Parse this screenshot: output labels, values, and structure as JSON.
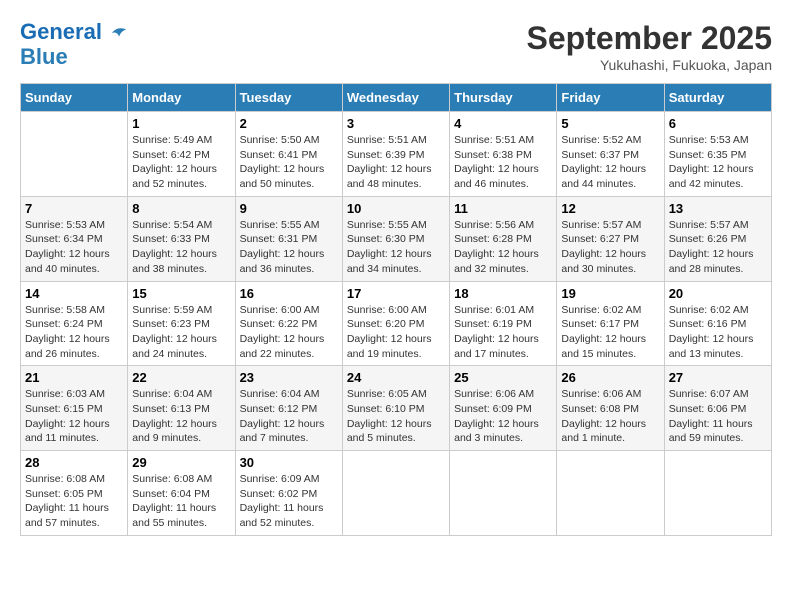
{
  "header": {
    "logo_line1": "General",
    "logo_line2": "Blue",
    "month_title": "September 2025",
    "location": "Yukuhashi, Fukuoka, Japan"
  },
  "days_of_week": [
    "Sunday",
    "Monday",
    "Tuesday",
    "Wednesday",
    "Thursday",
    "Friday",
    "Saturday"
  ],
  "weeks": [
    [
      {
        "day": "",
        "info": ""
      },
      {
        "day": "1",
        "info": "Sunrise: 5:49 AM\nSunset: 6:42 PM\nDaylight: 12 hours\nand 52 minutes."
      },
      {
        "day": "2",
        "info": "Sunrise: 5:50 AM\nSunset: 6:41 PM\nDaylight: 12 hours\nand 50 minutes."
      },
      {
        "day": "3",
        "info": "Sunrise: 5:51 AM\nSunset: 6:39 PM\nDaylight: 12 hours\nand 48 minutes."
      },
      {
        "day": "4",
        "info": "Sunrise: 5:51 AM\nSunset: 6:38 PM\nDaylight: 12 hours\nand 46 minutes."
      },
      {
        "day": "5",
        "info": "Sunrise: 5:52 AM\nSunset: 6:37 PM\nDaylight: 12 hours\nand 44 minutes."
      },
      {
        "day": "6",
        "info": "Sunrise: 5:53 AM\nSunset: 6:35 PM\nDaylight: 12 hours\nand 42 minutes."
      }
    ],
    [
      {
        "day": "7",
        "info": "Sunrise: 5:53 AM\nSunset: 6:34 PM\nDaylight: 12 hours\nand 40 minutes."
      },
      {
        "day": "8",
        "info": "Sunrise: 5:54 AM\nSunset: 6:33 PM\nDaylight: 12 hours\nand 38 minutes."
      },
      {
        "day": "9",
        "info": "Sunrise: 5:55 AM\nSunset: 6:31 PM\nDaylight: 12 hours\nand 36 minutes."
      },
      {
        "day": "10",
        "info": "Sunrise: 5:55 AM\nSunset: 6:30 PM\nDaylight: 12 hours\nand 34 minutes."
      },
      {
        "day": "11",
        "info": "Sunrise: 5:56 AM\nSunset: 6:28 PM\nDaylight: 12 hours\nand 32 minutes."
      },
      {
        "day": "12",
        "info": "Sunrise: 5:57 AM\nSunset: 6:27 PM\nDaylight: 12 hours\nand 30 minutes."
      },
      {
        "day": "13",
        "info": "Sunrise: 5:57 AM\nSunset: 6:26 PM\nDaylight: 12 hours\nand 28 minutes."
      }
    ],
    [
      {
        "day": "14",
        "info": "Sunrise: 5:58 AM\nSunset: 6:24 PM\nDaylight: 12 hours\nand 26 minutes."
      },
      {
        "day": "15",
        "info": "Sunrise: 5:59 AM\nSunset: 6:23 PM\nDaylight: 12 hours\nand 24 minutes."
      },
      {
        "day": "16",
        "info": "Sunrise: 6:00 AM\nSunset: 6:22 PM\nDaylight: 12 hours\nand 22 minutes."
      },
      {
        "day": "17",
        "info": "Sunrise: 6:00 AM\nSunset: 6:20 PM\nDaylight: 12 hours\nand 19 minutes."
      },
      {
        "day": "18",
        "info": "Sunrise: 6:01 AM\nSunset: 6:19 PM\nDaylight: 12 hours\nand 17 minutes."
      },
      {
        "day": "19",
        "info": "Sunrise: 6:02 AM\nSunset: 6:17 PM\nDaylight: 12 hours\nand 15 minutes."
      },
      {
        "day": "20",
        "info": "Sunrise: 6:02 AM\nSunset: 6:16 PM\nDaylight: 12 hours\nand 13 minutes."
      }
    ],
    [
      {
        "day": "21",
        "info": "Sunrise: 6:03 AM\nSunset: 6:15 PM\nDaylight: 12 hours\nand 11 minutes."
      },
      {
        "day": "22",
        "info": "Sunrise: 6:04 AM\nSunset: 6:13 PM\nDaylight: 12 hours\nand 9 minutes."
      },
      {
        "day": "23",
        "info": "Sunrise: 6:04 AM\nSunset: 6:12 PM\nDaylight: 12 hours\nand 7 minutes."
      },
      {
        "day": "24",
        "info": "Sunrise: 6:05 AM\nSunset: 6:10 PM\nDaylight: 12 hours\nand 5 minutes."
      },
      {
        "day": "25",
        "info": "Sunrise: 6:06 AM\nSunset: 6:09 PM\nDaylight: 12 hours\nand 3 minutes."
      },
      {
        "day": "26",
        "info": "Sunrise: 6:06 AM\nSunset: 6:08 PM\nDaylight: 12 hours\nand 1 minute."
      },
      {
        "day": "27",
        "info": "Sunrise: 6:07 AM\nSunset: 6:06 PM\nDaylight: 11 hours\nand 59 minutes."
      }
    ],
    [
      {
        "day": "28",
        "info": "Sunrise: 6:08 AM\nSunset: 6:05 PM\nDaylight: 11 hours\nand 57 minutes."
      },
      {
        "day": "29",
        "info": "Sunrise: 6:08 AM\nSunset: 6:04 PM\nDaylight: 11 hours\nand 55 minutes."
      },
      {
        "day": "30",
        "info": "Sunrise: 6:09 AM\nSunset: 6:02 PM\nDaylight: 11 hours\nand 52 minutes."
      },
      {
        "day": "",
        "info": ""
      },
      {
        "day": "",
        "info": ""
      },
      {
        "day": "",
        "info": ""
      },
      {
        "day": "",
        "info": ""
      }
    ]
  ]
}
